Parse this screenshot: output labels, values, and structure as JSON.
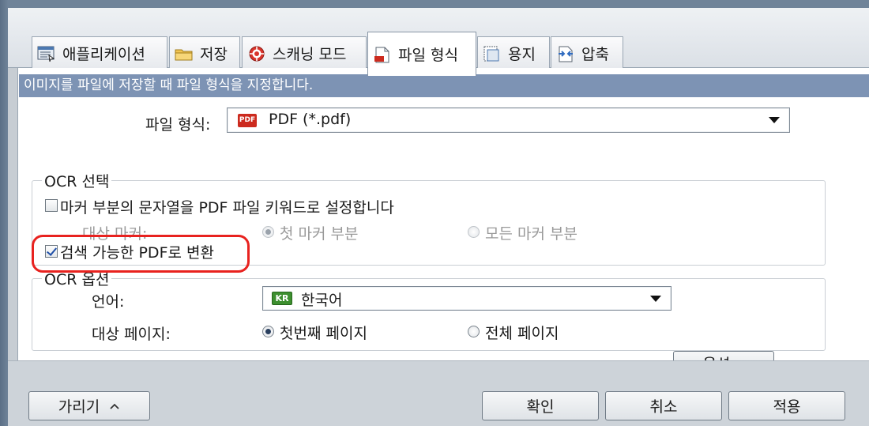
{
  "tabs": [
    {
      "label": "애플리케이션",
      "icon": "application-icon"
    },
    {
      "label": "저장",
      "icon": "folder-icon"
    },
    {
      "label": "스캐닝 모드",
      "icon": "scan-mode-icon"
    },
    {
      "label": "파일 형식",
      "icon": "file-format-icon",
      "active": true
    },
    {
      "label": "용지",
      "icon": "paper-icon"
    },
    {
      "label": "압축",
      "icon": "compression-icon"
    }
  ],
  "header": "이미지를 파일에 저장할 때 파일 형식을 지정합니다.",
  "file_format": {
    "label": "파일 형식:",
    "badge": "PDF",
    "value": "PDF (*.pdf)"
  },
  "ocr_select": {
    "legend": "OCR 선택",
    "marker_checkbox": {
      "label": "마커 부분의 문자열을 PDF 파일 키워드로 설정합니다",
      "checked": false
    },
    "target_marker": {
      "label": "대상 마커:",
      "option1": "첫 마커 부분",
      "option2": "모든 마커 부분"
    },
    "searchable_checkbox": {
      "label": "검색 가능한 PDF로 변환",
      "checked": true
    }
  },
  "ocr_options": {
    "legend": "OCR 옵션",
    "language_label": "언어:",
    "language_badge": "KR",
    "language_value": "한국어",
    "target_page_label": "대상 페이지:",
    "page_option1": "첫번째 페이지",
    "page_option2": "전체 페이지",
    "options_button": "옵션..."
  },
  "footer": {
    "hide_button": "가리기",
    "ok_button": "확인",
    "cancel_button": "취소",
    "apply_button": "적용"
  },
  "colors": {
    "header_band": "#7d93b4",
    "highlight": "#e8221f",
    "pdf_badge": "#cc2a1e",
    "kr_badge": "#3d8f2f"
  }
}
